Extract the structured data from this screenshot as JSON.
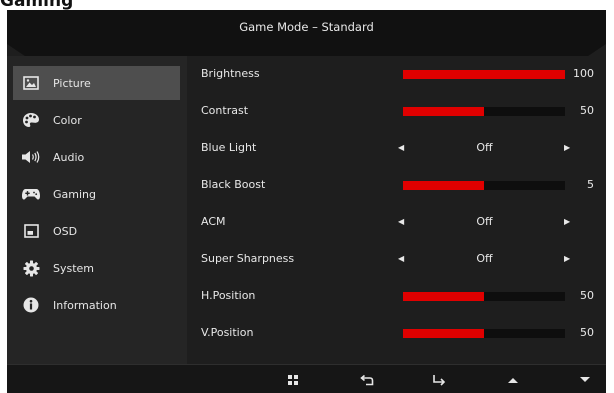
{
  "page_heading": "Gaming",
  "header": {
    "title": "Game Mode – Standard"
  },
  "sidebar": {
    "items": [
      {
        "label": "Picture",
        "icon": "picture-icon",
        "active": true
      },
      {
        "label": "Color",
        "icon": "palette-icon"
      },
      {
        "label": "Audio",
        "icon": "speaker-icon"
      },
      {
        "label": "Gaming",
        "icon": "gamepad-icon"
      },
      {
        "label": "OSD",
        "icon": "osd-window-icon"
      },
      {
        "label": "System",
        "icon": "gear-icon"
      },
      {
        "label": "Information",
        "icon": "info-icon"
      }
    ]
  },
  "main": {
    "rows": [
      {
        "label": "Brightness",
        "type": "slider",
        "value": "100",
        "level": 100
      },
      {
        "label": "Contrast",
        "type": "slider",
        "value": "50",
        "level": 50
      },
      {
        "label": "Blue Light",
        "type": "option",
        "value": "Off"
      },
      {
        "label": "Black Boost",
        "type": "slider",
        "value": "5",
        "level": 50
      },
      {
        "label": "ACM",
        "type": "option",
        "value": "Off"
      },
      {
        "label": "Super Sharpness",
        "type": "option",
        "value": "Off"
      },
      {
        "label": "H.Position",
        "type": "slider",
        "value": "50",
        "level": 50
      },
      {
        "label": "V.Position",
        "type": "slider",
        "value": "50",
        "level": 50
      }
    ]
  },
  "footer": {
    "buttons": [
      {
        "icon": "menu-grid-icon"
      },
      {
        "icon": "back-icon"
      },
      {
        "icon": "enter-icon"
      },
      {
        "icon": "up-arrow-icon"
      },
      {
        "icon": "down-arrow-icon"
      }
    ]
  },
  "colors": {
    "accent": "#e00000",
    "panel": "#1e1e1e",
    "header": "#111111",
    "active_item": "#4e4e4e"
  }
}
